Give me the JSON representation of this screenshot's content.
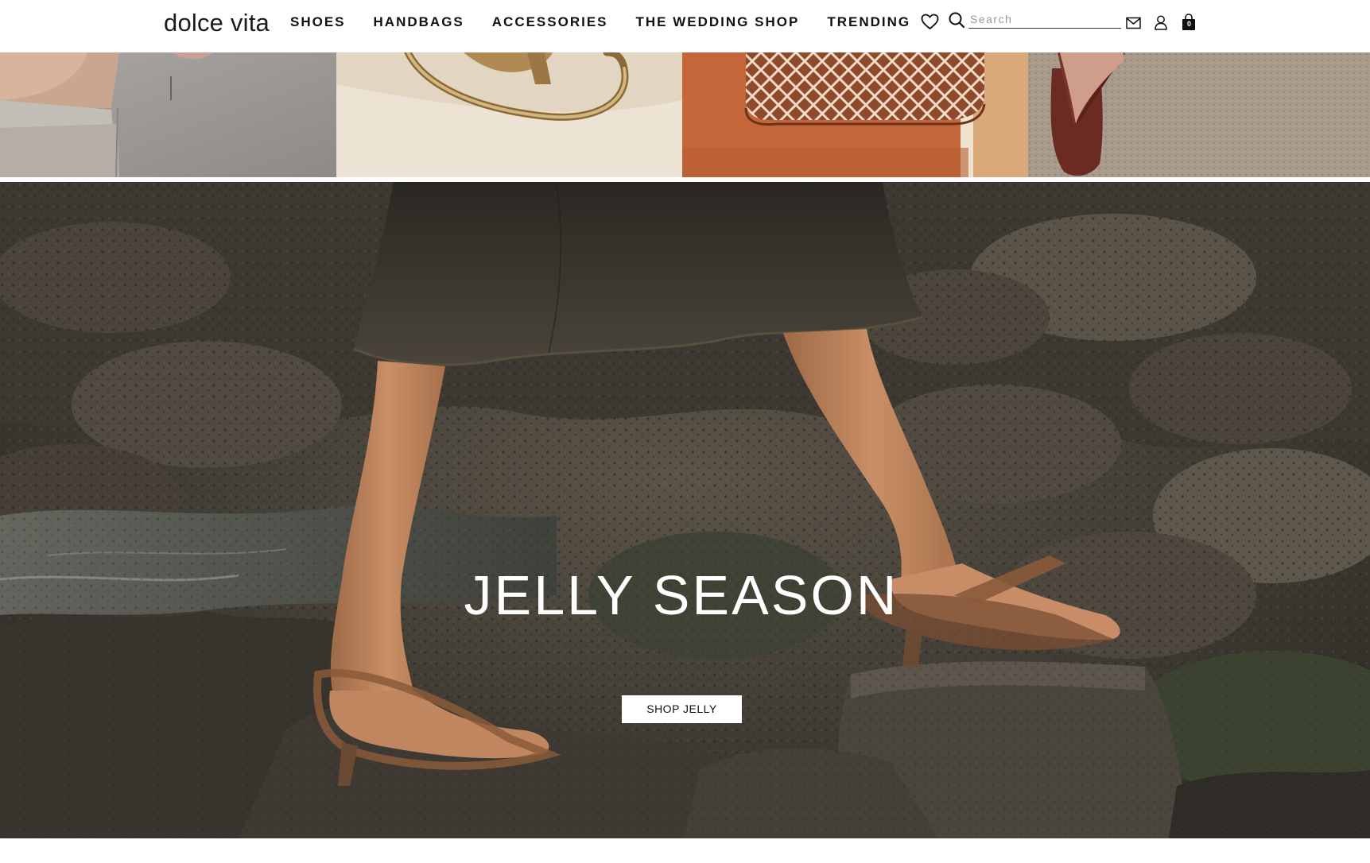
{
  "brand": {
    "logo_text": "dolce vita"
  },
  "nav": {
    "items": [
      {
        "label": "SHOES"
      },
      {
        "label": "HANDBAGS"
      },
      {
        "label": "ACCESSORIES"
      },
      {
        "label": "THE WEDDING SHOP"
      },
      {
        "label": "TRENDING"
      }
    ]
  },
  "header_icons": {
    "wishlist": "heart-icon",
    "search": "search-icon",
    "contact": "mail-icon",
    "account": "user-icon",
    "cart": "shopping-bag-icon"
  },
  "search": {
    "placeholder": "Search",
    "value": ""
  },
  "cart": {
    "count": "0"
  },
  "tiles": [
    {
      "subject": "leg-on-concrete-ledge"
    },
    {
      "subject": "gold-metallic-sandal"
    },
    {
      "subject": "woven-jelly-bag-on-orange-wall"
    },
    {
      "subject": "red-thong-sandal-on-sand"
    }
  ],
  "hero": {
    "title": "JELLY SEASON",
    "cta_label": "SHOP JELLY"
  },
  "colors": {
    "header_bg": "#ffffff",
    "text": "#111111",
    "hero_text": "#ffffff",
    "cta_bg": "#ffffff"
  }
}
